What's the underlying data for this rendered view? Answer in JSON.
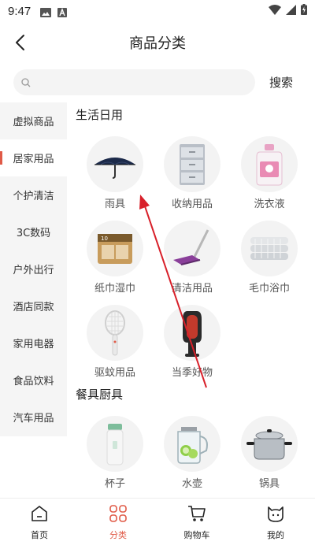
{
  "status_bar": {
    "time": "9:47"
  },
  "header": {
    "title": "商品分类"
  },
  "search": {
    "placeholder": "",
    "button_label": "搜索"
  },
  "sidebar": {
    "items": [
      {
        "label": "虚拟商品"
      },
      {
        "label": "居家用品",
        "active": true
      },
      {
        "label": "个护清洁"
      },
      {
        "label": "3C数码"
      },
      {
        "label": "户外出行"
      },
      {
        "label": "酒店同款"
      },
      {
        "label": "家用电器"
      },
      {
        "label": "食品饮料"
      },
      {
        "label": "汽车用品"
      }
    ]
  },
  "sections": [
    {
      "title": "生活日用",
      "items": [
        {
          "label": "雨具",
          "icon": "umbrella-icon"
        },
        {
          "label": "收纳用品",
          "icon": "storage-drawers-icon"
        },
        {
          "label": "洗衣液",
          "icon": "detergent-bottle-icon"
        },
        {
          "label": "纸巾湿巾",
          "icon": "tissue-box-icon"
        },
        {
          "label": "清洁用品",
          "icon": "mop-icon"
        },
        {
          "label": "毛巾浴巾",
          "icon": "towels-icon"
        },
        {
          "label": "驱蚊用品",
          "icon": "bug-zapper-racket-icon"
        },
        {
          "label": "当季好物",
          "icon": "bladeless-fan-icon"
        }
      ]
    },
    {
      "title": "餐具厨具",
      "items": [
        {
          "label": "杯子",
          "icon": "thermos-cup-icon"
        },
        {
          "label": "水壶",
          "icon": "glass-kettle-icon"
        },
        {
          "label": "锅具",
          "icon": "cooking-pot-icon"
        }
      ]
    }
  ],
  "tabbar": {
    "items": [
      {
        "label": "首页",
        "icon": "home-icon"
      },
      {
        "label": "分类",
        "icon": "category-grid-icon",
        "active": true
      },
      {
        "label": "购物车",
        "icon": "cart-icon"
      },
      {
        "label": "我的",
        "icon": "profile-cat-icon"
      }
    ]
  },
  "colors": {
    "accent": "#e05a47",
    "arrow": "#d8202a"
  }
}
